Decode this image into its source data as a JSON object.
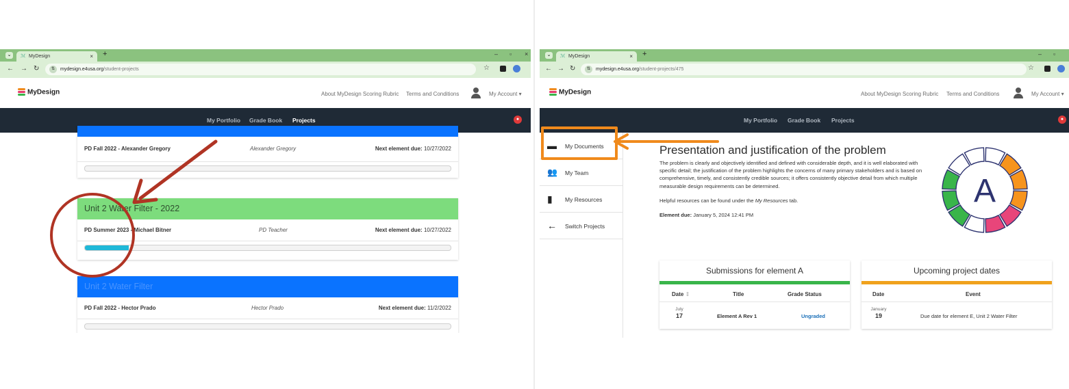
{
  "colors": {
    "accent_orange": "#f08a1c",
    "annotation_red": "#b03424",
    "chrome_green": "#8bc27f",
    "nav_dark": "#1f2a36",
    "card_green": "#7ddc7d",
    "card_blue": "#0a73ff",
    "progress_cyan": "#1fb8d8",
    "link_blue": "#1a6fb8"
  },
  "left": {
    "browser": {
      "tab_title": "MyDesign",
      "url_domain": "mydesign.e4usa.org",
      "url_path": "/student-projects"
    },
    "site": {
      "logo": "MyDesign",
      "links": [
        "About MyDesign Scoring Rubric",
        "Terms and Conditions"
      ],
      "account": "My Account",
      "nav": [
        "My Portfolio",
        "Grade Book",
        "Projects"
      ]
    },
    "cards": [
      {
        "header": "",
        "name": "PD Fall 2022 - Alexander Gregory",
        "teacher": "Alexander Gregory",
        "due_label": "Next element due:",
        "due_date": "10/27/2022",
        "progress": 0
      },
      {
        "header": "Unit 2 Water Filter - 2022",
        "name": "PD Summer 2023 - Michael Bitner",
        "teacher": "PD Teacher",
        "due_label": "Next element due:",
        "due_date": "10/27/2022",
        "progress": 0.12
      },
      {
        "header": "Unit 2 Water Filter",
        "name": "PD Fall 2022 - Hector Prado",
        "teacher": "Hector Prado",
        "due_label": "Next element due:",
        "due_date": "11/2/2022",
        "progress": 0
      }
    ]
  },
  "right": {
    "browser": {
      "tab_title": "MyDesign",
      "url_domain": "mydesign.e4usa.org",
      "url_path": "/student-projects/475"
    },
    "site": {
      "logo": "MyDesign",
      "links": [
        "About MyDesign Scoring Rubric",
        "Terms and Conditions"
      ],
      "account": "My Account",
      "nav": [
        "My Portfolio",
        "Grade Book",
        "Projects"
      ]
    },
    "sidebar": [
      {
        "label": "My Documents",
        "icon": "folder-icon"
      },
      {
        "label": "My Team",
        "icon": "team-icon"
      },
      {
        "label": "My Resources",
        "icon": "book-icon"
      },
      {
        "label": "Switch Projects",
        "icon": "arrow-left-icon"
      }
    ],
    "element": {
      "title": "Presentation and justification of the problem",
      "description": "The problem is clearly and objectively identified and defined with considerable depth, and it is well elaborated with specific detail; the justification of the problem highlights the concerns of many primary stakeholders and is based on comprehensive, timely, and consistently credible sources; it offers consistently objective detail from which multiple measurable design requirements can be determined.",
      "resources_prefix": "Helpful resources can be found under the ",
      "resources_link": "My Resources",
      "resources_suffix": " tab.",
      "due_label": "Element due:",
      "due_value": "January 5, 2024 12:41 PM",
      "letter": "A"
    },
    "submissions": {
      "title": "Submissions for element A",
      "columns": [
        "Date",
        "Title",
        "Grade Status"
      ],
      "rows": [
        {
          "month": "July",
          "day": "17",
          "title": "Element A Rev 1",
          "status": "Ungraded"
        }
      ]
    },
    "upcoming": {
      "title": "Upcoming project dates",
      "columns": [
        "Date",
        "Event"
      ],
      "rows": [
        {
          "month": "January",
          "day": "19",
          "event": "Due date for element E, Unit 2 Water Filter"
        }
      ]
    }
  }
}
